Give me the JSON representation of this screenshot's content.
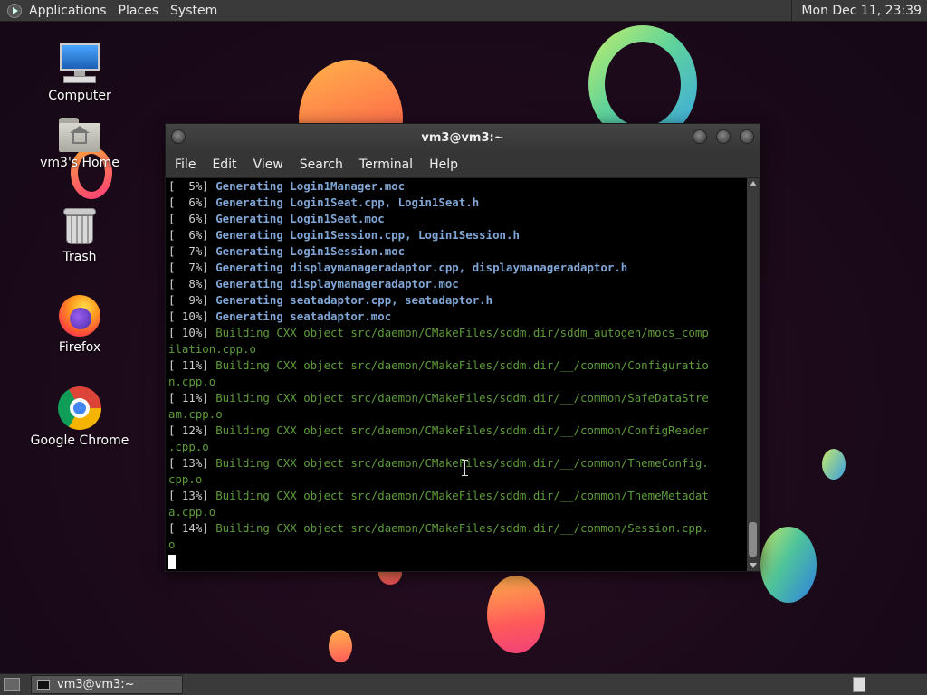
{
  "top_panel": {
    "menus": [
      "Applications",
      "Places",
      "System"
    ],
    "clock": "Mon Dec 11, 23:39"
  },
  "desktop_icons": [
    {
      "label": "Computer",
      "icon": "computer-icon"
    },
    {
      "label": "vm3's Home",
      "icon": "home-folder-icon"
    },
    {
      "label": "Trash",
      "icon": "trash-icon"
    },
    {
      "label": "Firefox",
      "icon": "firefox-icon"
    },
    {
      "label": "Google Chrome",
      "icon": "chrome-icon"
    }
  ],
  "terminal": {
    "title": "vm3@vm3:~",
    "menus": [
      "File",
      "Edit",
      "View",
      "Search",
      "Terminal",
      "Help"
    ],
    "lines": [
      {
        "pct": "[  5%] ",
        "text": "Generating Login1Manager.moc",
        "kind": "gen"
      },
      {
        "pct": "[  6%] ",
        "text": "Generating Login1Seat.cpp, Login1Seat.h",
        "kind": "gen"
      },
      {
        "pct": "[  6%] ",
        "text": "Generating Login1Seat.moc",
        "kind": "gen"
      },
      {
        "pct": "[  6%] ",
        "text": "Generating Login1Session.cpp, Login1Session.h",
        "kind": "gen"
      },
      {
        "pct": "[  7%] ",
        "text": "Generating Login1Session.moc",
        "kind": "gen"
      },
      {
        "pct": "[  7%] ",
        "text": "Generating displaymanageradaptor.cpp, displaymanageradaptor.h",
        "kind": "gen"
      },
      {
        "pct": "[  8%] ",
        "text": "Generating displaymanageradaptor.moc",
        "kind": "gen"
      },
      {
        "pct": "[  9%] ",
        "text": "Generating seatadaptor.cpp, seatadaptor.h",
        "kind": "gen"
      },
      {
        "pct": "[ 10%] ",
        "text": "Generating seatadaptor.moc",
        "kind": "gen"
      },
      {
        "pct": "[ 10%] ",
        "text": "Building CXX object src/daemon/CMakeFiles/sddm.dir/sddm_autogen/mocs_comp",
        "kind": "bld"
      },
      {
        "pct": "",
        "text": "ilation.cpp.o",
        "kind": "bld"
      },
      {
        "pct": "[ 11%] ",
        "text": "Building CXX object src/daemon/CMakeFiles/sddm.dir/__/common/Configuratio",
        "kind": "bld"
      },
      {
        "pct": "",
        "text": "n.cpp.o",
        "kind": "bld"
      },
      {
        "pct": "[ 11%] ",
        "text": "Building CXX object src/daemon/CMakeFiles/sddm.dir/__/common/SafeDataStre",
        "kind": "bld"
      },
      {
        "pct": "",
        "text": "am.cpp.o",
        "kind": "bld"
      },
      {
        "pct": "[ 12%] ",
        "text": "Building CXX object src/daemon/CMakeFiles/sddm.dir/__/common/ConfigReader",
        "kind": "bld"
      },
      {
        "pct": "",
        "text": ".cpp.o",
        "kind": "bld"
      },
      {
        "pct": "[ 13%] ",
        "text": "Building CXX object src/daemon/CMakeFiles/sddm.dir/__/common/ThemeConfig.",
        "kind": "bld"
      },
      {
        "pct": "",
        "text": "cpp.o",
        "kind": "bld"
      },
      {
        "pct": "[ 13%] ",
        "text": "Building CXX object src/daemon/CMakeFiles/sddm.dir/__/common/ThemeMetadat",
        "kind": "bld"
      },
      {
        "pct": "",
        "text": "a.cpp.o",
        "kind": "bld"
      },
      {
        "pct": "[ 14%] ",
        "text": "Building CXX object src/daemon/CMakeFiles/sddm.dir/__/common/Session.cpp.",
        "kind": "bld"
      },
      {
        "pct": "",
        "text": "o",
        "kind": "bld"
      }
    ]
  },
  "taskbar": {
    "window_button": "vm3@vm3:~"
  },
  "colors": {
    "generating": "#7fa6d6",
    "building": "#5e9c3a",
    "panel": "#3a3a3a"
  }
}
